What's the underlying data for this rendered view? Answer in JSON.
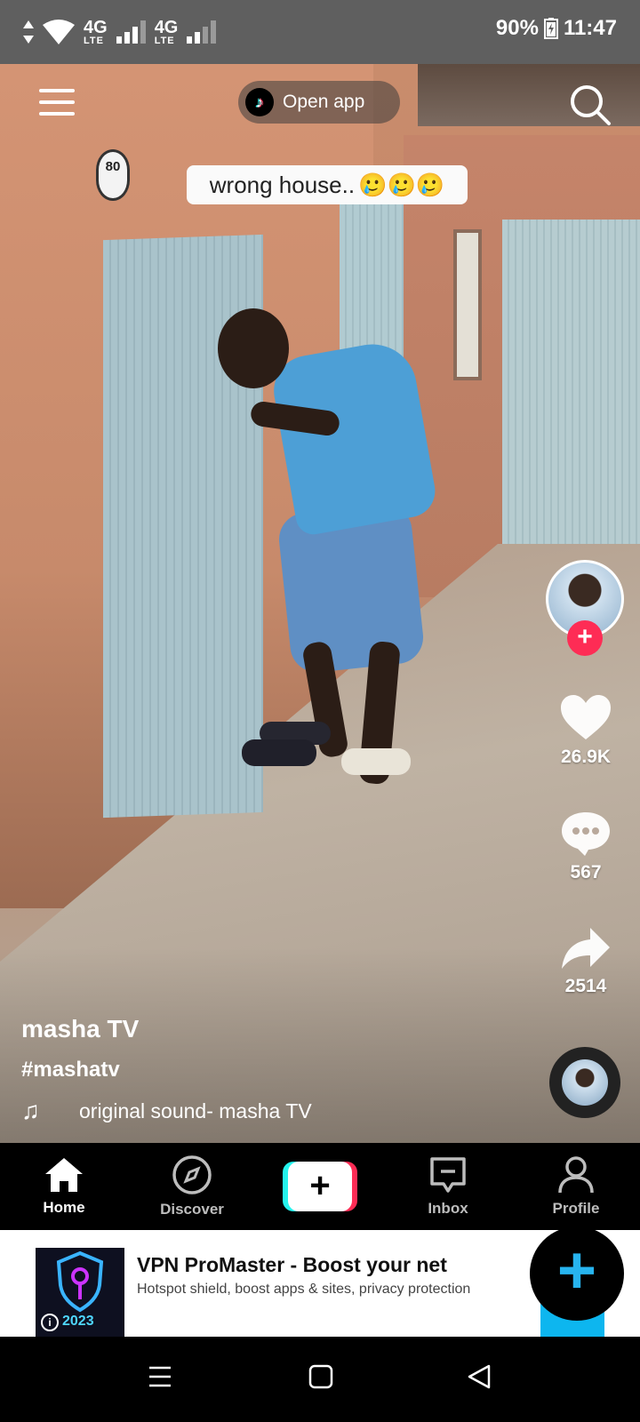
{
  "status_bar": {
    "network1": "4G",
    "network1_sub": "LTE",
    "network2": "4G",
    "network2_sub": "LTE",
    "battery": "90%",
    "time": "11:47"
  },
  "top_bar": {
    "open_app_label": "Open app",
    "tiktok_logo_glyph": "♪",
    "menu_icon": "hamburger-icon",
    "search_icon": "search-icon"
  },
  "video": {
    "caption_overlay": "wrong house..",
    "caption_emojis": "🥲🥲🥲",
    "sign_text": "80",
    "username": "masha TV",
    "hashtag": "#mashatv",
    "sound": "original sound- masha TV"
  },
  "actions": {
    "likes": "26.9K",
    "comments": "567",
    "shares": "2514",
    "follow_symbol": "+"
  },
  "nav": {
    "items": [
      {
        "label": "Home",
        "icon": "home-icon"
      },
      {
        "label": "Discover",
        "icon": "compass-icon"
      },
      {
        "label": "",
        "icon": "create-plus-icon"
      },
      {
        "label": "Inbox",
        "icon": "inbox-icon"
      },
      {
        "label": "Profile",
        "icon": "person-icon"
      }
    ],
    "create_symbol": "+"
  },
  "ad": {
    "title": "VPN ProMaster - Boost your net",
    "subtitle": "Hotspot shield, boost apps & sites, privacy protection",
    "year": "2023",
    "info": "i",
    "fab_symbol": "+",
    "accent_color": "#0db6ef"
  },
  "colors": {
    "status_bar": "#5f5f5f",
    "tiktok_red": "#fe2c55",
    "tiktok_cyan": "#25f4ee"
  }
}
